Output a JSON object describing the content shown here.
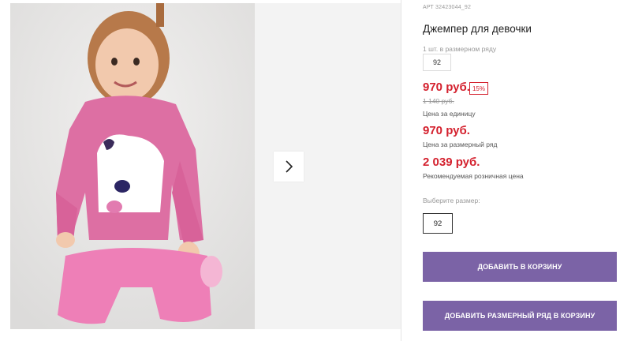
{
  "product": {
    "article": "АРТ 32423044_92",
    "title": "Джемпер для девочки",
    "pack_label": "1 шт. в размерном ряду",
    "pack_size": "92",
    "price": "970 руб.",
    "discount": "15%",
    "old_price": "1 140 руб.",
    "unit_price_label": "Цена за единицу",
    "pack_price": "970 руб.",
    "pack_price_label": "Цена за размерный ряд",
    "rrp": "2 039 руб.",
    "rrp_label": "Рекомендуемая розничная цена",
    "select_size_label": "Выберите размер:",
    "selected_size": "92"
  },
  "actions": {
    "add_to_cart": "ДОБАВИТЬ В КОРЗИНУ",
    "add_pack_to_cart": "ДОБАВИТЬ РАЗМЕРНЫЙ РЯД В КОРЗИНУ"
  },
  "colors": {
    "price_red": "#d4212e",
    "button_purple": "#7b63a6"
  },
  "icons": {
    "next": "chevron-right-icon"
  }
}
